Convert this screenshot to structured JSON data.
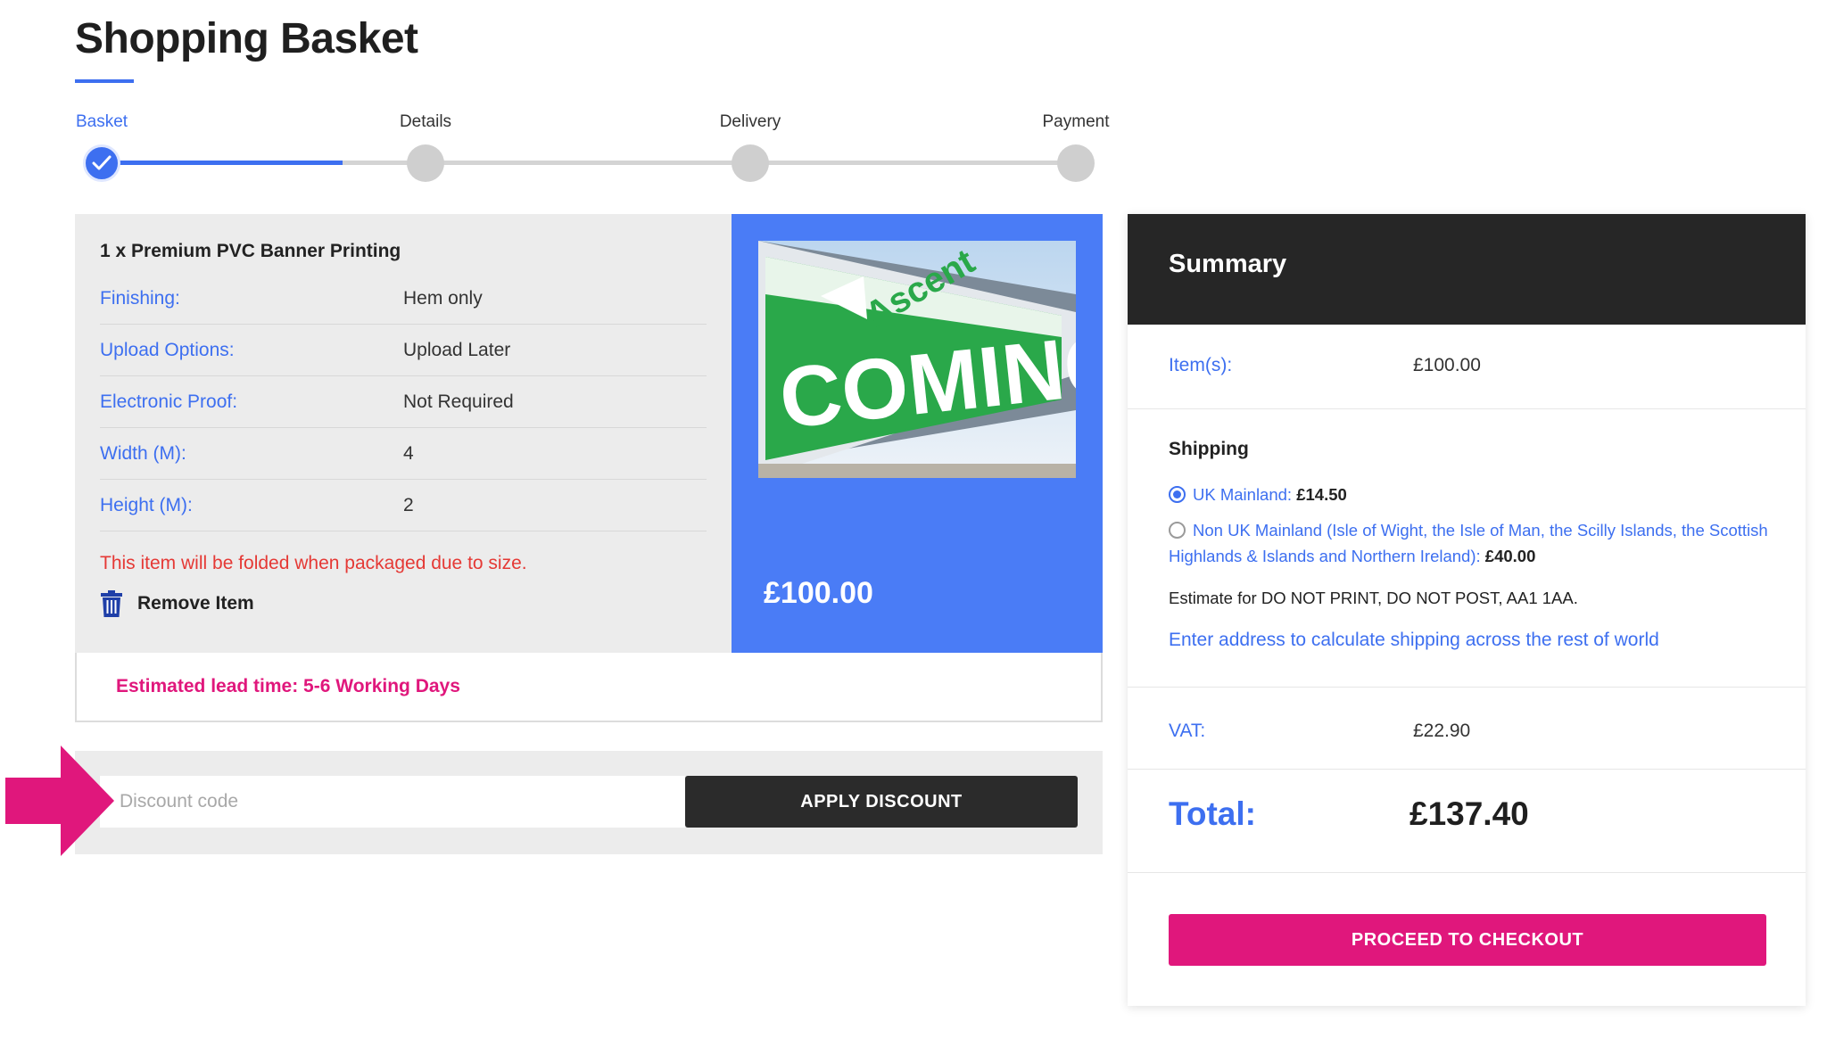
{
  "page": {
    "title": "Shopping Basket"
  },
  "stepper": {
    "steps": [
      {
        "label": "Basket",
        "state": "complete"
      },
      {
        "label": "Details",
        "state": "pending"
      },
      {
        "label": "Delivery",
        "state": "pending"
      },
      {
        "label": "Payment",
        "state": "pending"
      }
    ]
  },
  "item": {
    "title": "1 x Premium PVC Banner Printing",
    "options": [
      {
        "key": "Finishing:",
        "value": "Hem only"
      },
      {
        "key": "Upload Options:",
        "value": "Upload Later"
      },
      {
        "key": "Electronic Proof:",
        "value": "Not Required"
      },
      {
        "key": "Width (M):",
        "value": "4"
      },
      {
        "key": "Height (M):",
        "value": "2"
      }
    ],
    "fold_note": "This item will be folded when packaged due to size.",
    "remove_label": "Remove Item",
    "price": "£100.00",
    "image": {
      "banner_text": "COMING SO",
      "brand_text": "Ascent"
    },
    "lead_time": "Estimated lead time: 5-6 Working Days"
  },
  "discount": {
    "placeholder": "Discount code",
    "value": "",
    "apply_label": "APPLY DISCOUNT"
  },
  "summary": {
    "title": "Summary",
    "items_label": "Item(s):",
    "items_value": "£100.00",
    "shipping_title": "Shipping",
    "shipping_options": [
      {
        "label": "UK Mainland:",
        "price": "£14.50",
        "selected": true
      },
      {
        "label": "Non UK Mainland (Isle of Wight, the Isle of Man, the Scilly Islands, the Scottish Highlands & Islands and Northern Ireland):",
        "price": "£40.00",
        "selected": false
      }
    ],
    "estimate_text": "Estimate for DO NOT PRINT, DO NOT POST, AA1 1AA.",
    "calc_link": "Enter address to calculate shipping across the rest of world",
    "vat_label": "VAT:",
    "vat_value": "£22.90",
    "total_label": "Total:",
    "total_value": "£137.40",
    "checkout_label": "PROCEED TO CHECKOUT"
  },
  "colors": {
    "accent_blue": "#3d6ff0",
    "price_panel_blue": "#4a7cf6",
    "brand_pink": "#e0177c",
    "warning_red": "#e53935",
    "dark": "#262626"
  }
}
